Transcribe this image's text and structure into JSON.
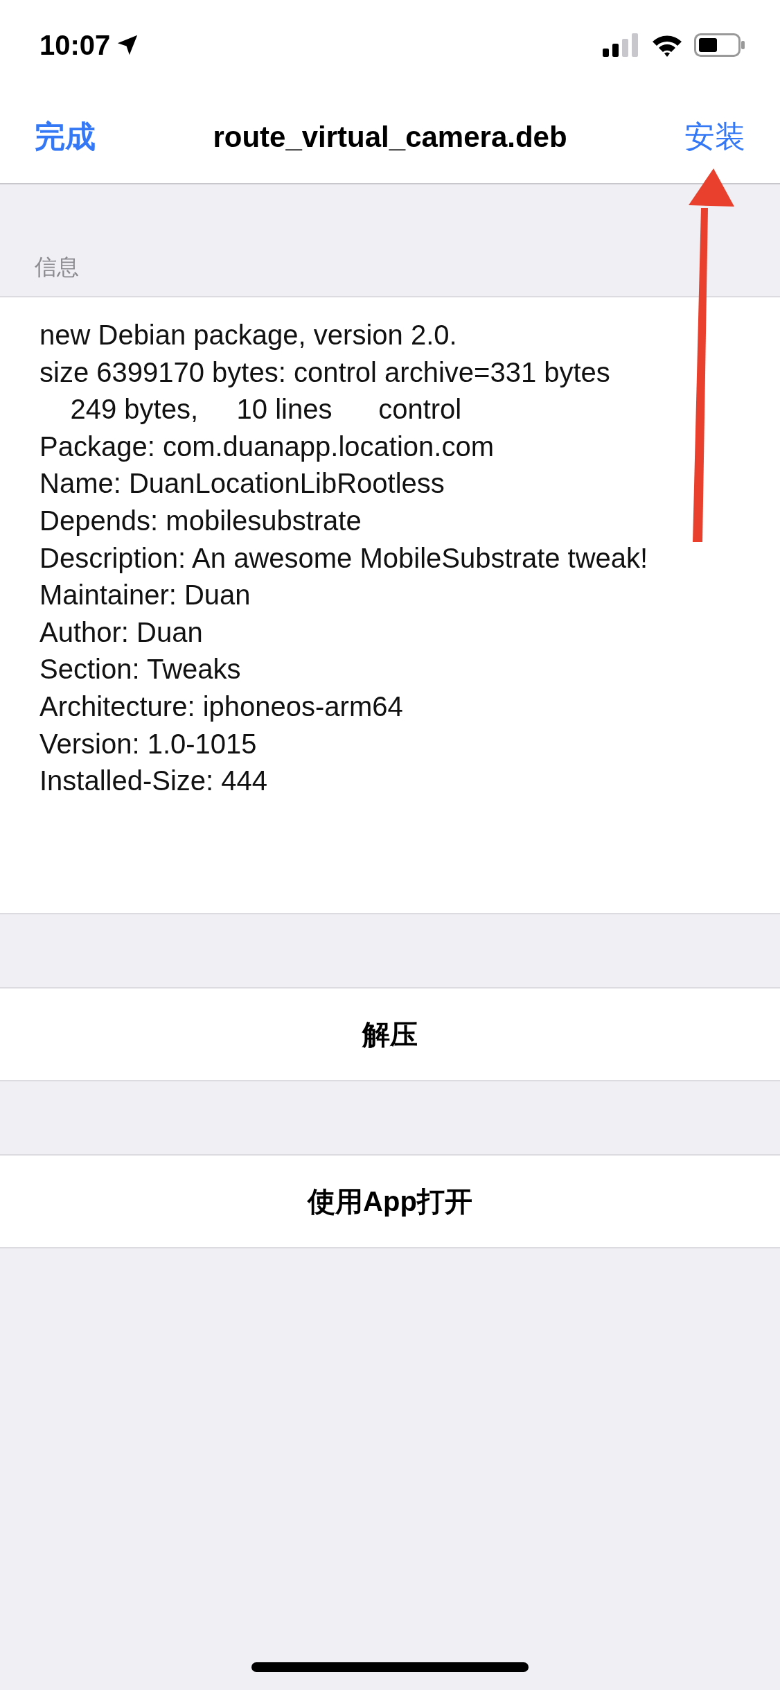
{
  "status_bar": {
    "time": "10:07"
  },
  "nav": {
    "left_button": "完成",
    "title": "route_virtual_camera.deb",
    "right_button": "安装"
  },
  "info": {
    "header": "信息",
    "lines": [
      "new Debian package, version 2.0.",
      "size 6399170 bytes: control archive=331 bytes",
      "    249 bytes,     10 lines      control",
      "Package: com.duanapp.location.com",
      "Name: DuanLocationLibRootless",
      "Depends: mobilesubstrate",
      "Description: An awesome MobileSubstrate tweak!",
      "Maintainer: Duan",
      "Author: Duan",
      "Section: Tweaks",
      "Architecture: iphoneos-arm64",
      "Version: 1.0-1015",
      "Installed-Size: 444"
    ]
  },
  "actions": [
    {
      "label": "解压"
    },
    {
      "label": "使用App打开"
    }
  ]
}
